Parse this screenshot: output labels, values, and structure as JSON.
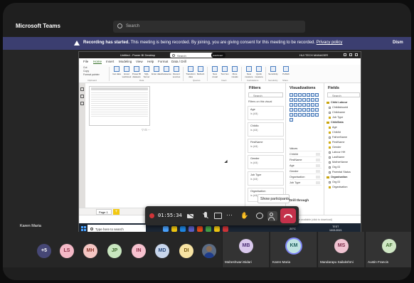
{
  "teams": {
    "app_title": "Microsoft Teams",
    "search_placeholder": "Search",
    "banner": {
      "bold": "Recording has started.",
      "text": " This meeting is being recorded. By joining, you are giving consent for this meeting to be recorded.",
      "link": "Privacy policy",
      "dismiss": "Dism"
    },
    "presenter_name": "Karen Maria",
    "call_timer": "01:55:34",
    "tooltip": "Show participants"
  },
  "powerbi": {
    "title": "Untitled - Power BI Desktop",
    "search": "Search",
    "autosmart": "AutoSmart",
    "user": "HUI TECH MANAGER",
    "menu": [
      "File",
      "Home",
      "Insert",
      "Modeling",
      "View",
      "Help",
      "Format",
      "Data / Drill"
    ],
    "ribbon_buttons": [
      "Get data",
      "Excel workbook",
      "Power BI datasets",
      "SQL Server",
      "Enter data",
      "Dataverse",
      "Recent sources",
      "Transform data",
      "Refresh",
      "New visual",
      "Text box",
      "More visuals",
      "New measure",
      "Quick measure",
      "Sensitivity",
      "Publish"
    ],
    "ribbon_small": [
      "Cut",
      "Copy",
      "Format painter"
    ],
    "ribbon_groups": [
      "Clipboard",
      "Data",
      "Queries",
      "Insert",
      "Calculations",
      "Sensitivity",
      "Share"
    ],
    "page_tab": "Page 1",
    "add_page": "+",
    "filters": {
      "title": "Filters",
      "search": "Search",
      "section": "Filters on this visual",
      "cards": [
        {
          "label": "Age",
          "value": "is (All)"
        },
        {
          "label": "Childlo",
          "value": "is (All)"
        },
        {
          "label": "FirstName",
          "value": "is (All)"
        },
        {
          "label": "Gender",
          "value": "is (All)"
        },
        {
          "label": "Job Type",
          "value": "is (All)"
        },
        {
          "label": "Organisation",
          "value": "is (All)"
        }
      ]
    },
    "visualizations": {
      "title": "Visualizations",
      "rows": [
        "Values",
        "ChildId",
        "FirstName",
        "Age",
        "Gender",
        "Organisation",
        "Job Type"
      ],
      "drill_title": "Drill through"
    },
    "fields": {
      "title": "Fields",
      "search": "Search",
      "items": [
        {
          "name": "Child Labour",
          "table": true
        },
        {
          "name": "Childlabourid",
          "checked": false
        },
        {
          "name": "Childname",
          "checked": false
        },
        {
          "name": "Job Type",
          "checked": true
        },
        {
          "name": "ChildData",
          "table": true
        },
        {
          "name": "Age",
          "checked": true
        },
        {
          "name": "ChildId",
          "checked": true
        },
        {
          "name": "FatherName",
          "checked": false
        },
        {
          "name": "FirstName",
          "checked": true
        },
        {
          "name": "Gender",
          "checked": true
        },
        {
          "name": "Labour HH",
          "checked": false
        },
        {
          "name": "LastName",
          "checked": false
        },
        {
          "name": "MotherName",
          "checked": false
        },
        {
          "name": "Org ID",
          "checked": false
        },
        {
          "name": "Parental Status",
          "checked": false
        },
        {
          "name": "Organisation",
          "table": true
        },
        {
          "name": "Org ID",
          "checked": false
        },
        {
          "name": "Organisation",
          "checked": true
        }
      ]
    },
    "status_bar": "Update available (click to download)"
  },
  "taskbar": {
    "search_placeholder": "Type here to search",
    "temperature": "20°C",
    "time": "TEST",
    "date": "10/21/2021"
  },
  "participants": {
    "overflow": "+5",
    "avatars": [
      {
        "initials": "LS",
        "bg": "#f3b8c6",
        "fg": "#8a2c44"
      },
      {
        "initials": "MH",
        "bg": "#f5c6c3",
        "fg": "#8d3a2f"
      },
      {
        "initials": "JP",
        "bg": "#c8e6bf",
        "fg": "#3f6b2e"
      },
      {
        "initials": "IN",
        "bg": "#f7c2cf",
        "fg": "#8a2c44"
      },
      {
        "initials": "MD",
        "bg": "#c8d6ec",
        "fg": "#2c4c7d"
      },
      {
        "initials": "DI",
        "bg": "#f7e3a3",
        "fg": "#7a5a11"
      }
    ],
    "tiles": [
      {
        "initials": "MB",
        "name": "Maheshwari Bidari",
        "bg": "#d9c8ec",
        "fg": "#4e3278"
      },
      {
        "initials": "KM",
        "name": "Karen Maria",
        "bg": "#bfe3e1",
        "fg": "#1e5e5a"
      },
      {
        "initials": "MS",
        "name": "Mandarapu Sailakshmi",
        "bg": "#f0c4d2",
        "fg": "#7d2c48"
      },
      {
        "initials": "AF",
        "name": "Austin Francis",
        "bg": "#cfe7c4",
        "fg": "#3f6b2e"
      }
    ]
  }
}
